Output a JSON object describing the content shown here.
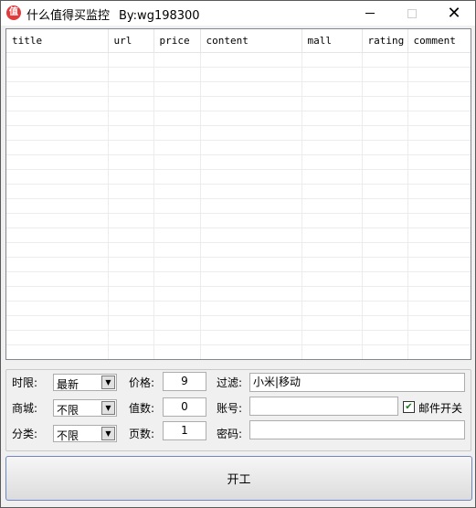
{
  "window": {
    "icon_char": "值",
    "title": "什么值得买监控",
    "author": "By:wg198300"
  },
  "grid": {
    "columns": [
      "title",
      "url",
      "price",
      "content",
      "mall",
      "rating",
      "comment"
    ],
    "rows": []
  },
  "controls": {
    "time_label": "时限:",
    "time_value": "最新",
    "mall_label": "商城:",
    "mall_value": "不限",
    "category_label": "分类:",
    "category_value": "不限",
    "price_label": "价格:",
    "price_value": "9",
    "worth_label": "值数:",
    "worth_value": "0",
    "pages_label": "页数:",
    "pages_value": "1",
    "filter_label": "过滤:",
    "filter_value": "小米|移动",
    "account_label": "账号:",
    "account_value": "",
    "password_label": "密码:",
    "password_value": "",
    "email_label": "邮件开关",
    "email_checked": true
  },
  "start_button": {
    "label": "开工"
  }
}
